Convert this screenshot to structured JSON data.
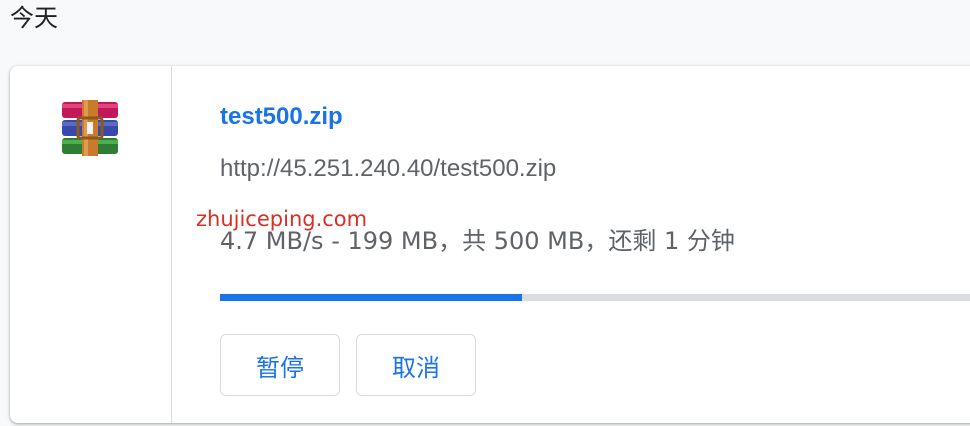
{
  "section": {
    "heading": "今天"
  },
  "download": {
    "file_name": "test500.zip",
    "url": "http://45.251.240.40/test500.zip",
    "status": "4.7 MB/s - 199 MB，共 500 MB，还剩 1 分钟",
    "progress_fraction": 0.398,
    "icon": "winrar-archive-icon",
    "actions": {
      "pause_label": "暂停",
      "cancel_label": "取消"
    }
  },
  "watermark": "zhujiceping.com",
  "colors": {
    "accent": "#1a73e8",
    "track": "#dadce0",
    "watermark": "#d93025",
    "text_secondary": "#5f6368"
  }
}
